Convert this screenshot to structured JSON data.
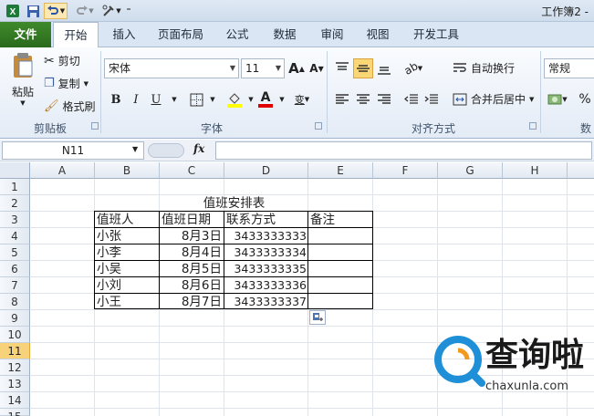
{
  "window": {
    "title": "工作簿2 -"
  },
  "quick_access": {
    "save_icon": "save-icon",
    "undo_icon": "undo-icon",
    "redo_icon": "redo-icon",
    "customize_icon": "customize-icon"
  },
  "tabs": [
    {
      "label": "文件"
    },
    {
      "label": "开始"
    },
    {
      "label": "插入"
    },
    {
      "label": "页面布局"
    },
    {
      "label": "公式"
    },
    {
      "label": "数据"
    },
    {
      "label": "审阅"
    },
    {
      "label": "视图"
    },
    {
      "label": "开发工具"
    }
  ],
  "ribbon": {
    "clipboard": {
      "paste": "粘贴",
      "cut": "剪切",
      "copy": "复制",
      "format_painter": "格式刷",
      "group": "剪贴板"
    },
    "font": {
      "name": "宋体",
      "size": "11",
      "grow": "A",
      "shrink": "A",
      "bold": "B",
      "italic": "I",
      "underline": "U",
      "wen": "变",
      "group": "字体"
    },
    "alignment": {
      "wrap": "自动换行",
      "merge": "合并后居中",
      "group": "对齐方式"
    },
    "number": {
      "format": "常规",
      "percent": "%",
      "group": "数"
    }
  },
  "formula_bar": {
    "name_box": "N11",
    "fx": "fx",
    "value": ""
  },
  "columns": [
    "A",
    "B",
    "C",
    "D",
    "E",
    "F",
    "G",
    "H"
  ],
  "rows": [
    "1",
    "2",
    "3",
    "4",
    "5",
    "6",
    "7",
    "8",
    "9",
    "10",
    "11",
    "12",
    "13",
    "14",
    "15"
  ],
  "selected_row": "11",
  "sheet": {
    "title": "值班安排表",
    "headers": [
      "值班人",
      "值班日期",
      "联系方式",
      "备注"
    ],
    "records": [
      {
        "name": "小张",
        "date": "8月3日",
        "phone": "3433333333",
        "note": ""
      },
      {
        "name": "小李",
        "date": "8月4日",
        "phone": "3433333334",
        "note": ""
      },
      {
        "name": "小吴",
        "date": "8月5日",
        "phone": "3433333335",
        "note": ""
      },
      {
        "name": "小刘",
        "date": "8月6日",
        "phone": "3433333336",
        "note": ""
      },
      {
        "name": "小王",
        "date": "8月7日",
        "phone": "3433333337",
        "note": ""
      }
    ]
  },
  "watermark": {
    "logo_text": "查询啦",
    "url": "chaxunla.com"
  },
  "colors": {
    "file_tab": "#2f7321",
    "selected_row": "#f8d27a",
    "watermark_blue": "#1f8fd8",
    "watermark_orange": "#f29a1f"
  }
}
